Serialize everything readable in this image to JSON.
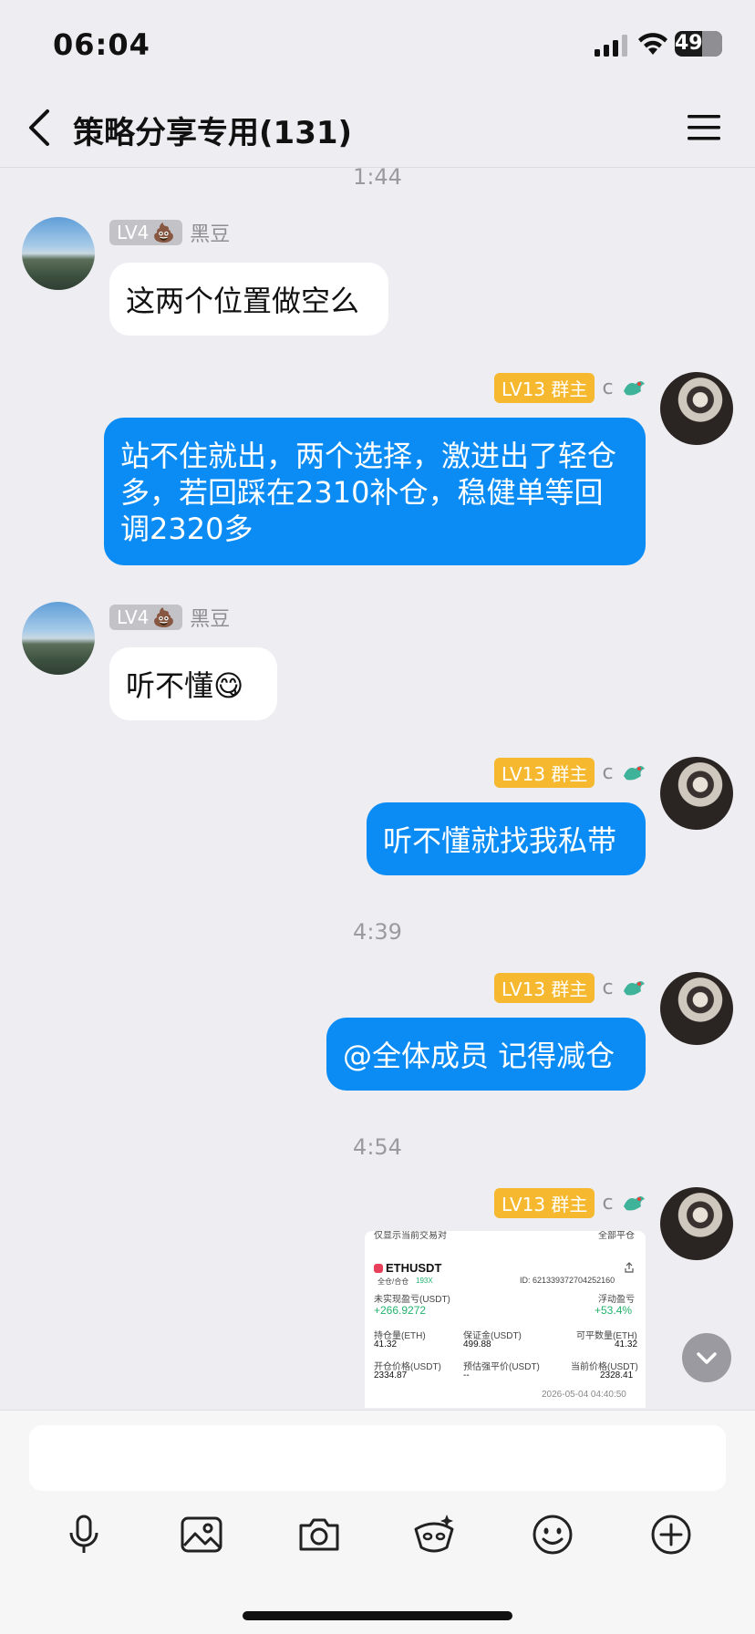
{
  "status_bar": {
    "time": "06:04",
    "battery": "49"
  },
  "nav": {
    "title": "策略分享专用(131)"
  },
  "time_labels": [
    "1:44",
    "4:39",
    "4:54"
  ],
  "messages": [
    {
      "sender": {
        "level": "LV4",
        "name": "黑豆",
        "emoji": "💩"
      },
      "text": "这两个位置做空么"
    },
    {
      "sender": {
        "level": "LV13 群主",
        "name": "c"
      },
      "text": "站不住就出，两个选择，激进出了轻仓多，若回踩在2310补仓，稳健单等回调2320多"
    },
    {
      "sender": {
        "level": "LV4",
        "name": "黑豆",
        "emoji": "💩"
      },
      "text": "听不懂",
      "sticker": "😋"
    },
    {
      "sender": {
        "level": "LV13 群主",
        "name": "c"
      },
      "text": "听不懂就找我私带"
    },
    {
      "sender": {
        "level": "LV13 群主",
        "name": "c"
      },
      "text": "@全体成员 记得减仓"
    },
    {
      "sender": {
        "level": "LV13 群主",
        "name": "c"
      }
    }
  ],
  "position_card": {
    "top_left": "仅显示当前交易对",
    "top_right": "全部平仓",
    "symbol": "ETHUSDT",
    "mode": "全仓/合仓",
    "leverage": "193X",
    "id": "ID: 621339372704252160",
    "unrealized_pnl_label": "未实现盈亏(USDT)",
    "unrealized_pnl": "+266.9272",
    "roe_label": "浮动盈亏",
    "roe": "+53.4%",
    "size_label": "持仓量(ETH)",
    "size": "41.32",
    "margin_label": "保证金(USDT)",
    "margin": "499.88",
    "closable_label": "可平数量(ETH)",
    "closable": "41.32",
    "entry_label": "开仓价格(USDT)",
    "entry": "2334.87",
    "liq_label": "预估强平价(USDT)",
    "liq": "--",
    "mark_label": "当前价格(USDT)",
    "mark": "2328.41",
    "timestamp": "2026-05-04 04:40:50"
  },
  "icons": {
    "toolbar": [
      "microphone-icon",
      "image-icon",
      "camera-icon",
      "red-packet-icon",
      "emoji-icon",
      "plus-icon"
    ]
  },
  "colors": {
    "outgoing_bubble": "#0a8cf4",
    "owner_badge": "#f5b82e",
    "background": "#eeeef2"
  }
}
